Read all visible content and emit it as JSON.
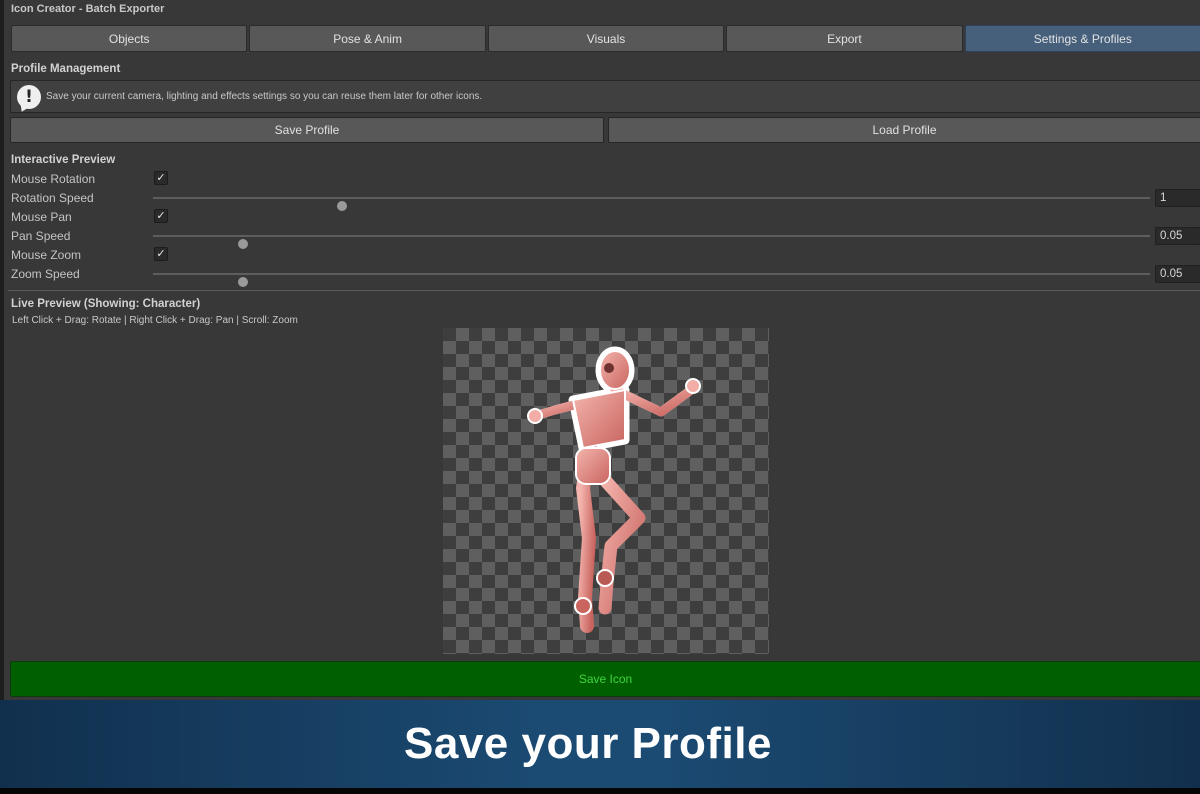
{
  "window": {
    "title": "Icon Creator - Batch Exporter"
  },
  "tabs": [
    {
      "label": "Objects",
      "active": false
    },
    {
      "label": "Pose & Anim",
      "active": false
    },
    {
      "label": "Visuals",
      "active": false
    },
    {
      "label": "Export",
      "active": false
    },
    {
      "label": "Settings & Profiles",
      "active": true
    }
  ],
  "profile": {
    "heading": "Profile Management",
    "help_text": "Save your current camera, lighting and effects settings so you can reuse them later for other icons.",
    "save_label": "Save Profile",
    "load_label": "Load Profile"
  },
  "interactive": {
    "heading": "Interactive Preview",
    "mouse_rotation": {
      "label": "Mouse Rotation",
      "checked": true
    },
    "rotation_speed": {
      "label": "Rotation Speed",
      "value": "1",
      "slider_fraction": 0.19
    },
    "mouse_pan": {
      "label": "Mouse Pan",
      "checked": true
    },
    "pan_speed": {
      "label": "Pan Speed",
      "value": "0.05",
      "slider_fraction": 0.09
    },
    "mouse_zoom": {
      "label": "Mouse Zoom",
      "checked": true
    },
    "zoom_speed": {
      "label": "Zoom Speed",
      "value": "0.05",
      "slider_fraction": 0.09
    }
  },
  "live_preview": {
    "heading": "Live Preview (Showing: Character)",
    "hint": "Left Click + Drag: Rotate | Right Click + Drag: Pan | Scroll: Zoom"
  },
  "save_icon_label": "Save Icon",
  "banner": {
    "text": "Save your Profile"
  },
  "colors": {
    "active_tab": "#46607c",
    "save_icon_bg": "#006000",
    "save_icon_text": "#3fd43f",
    "banner": "#1b4a72"
  }
}
